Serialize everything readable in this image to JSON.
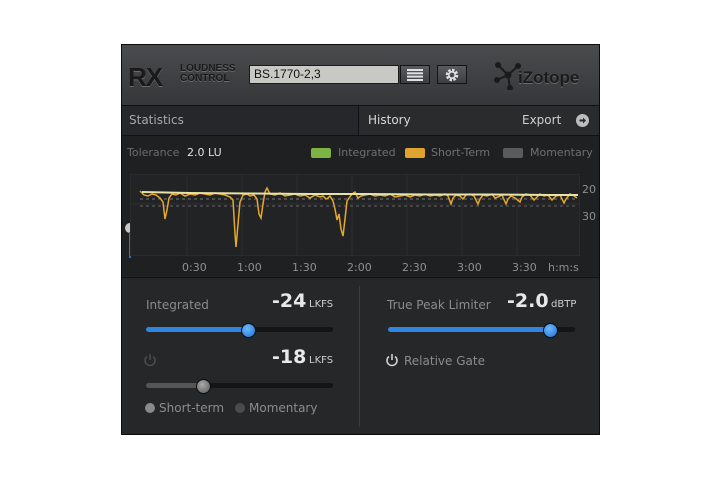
{
  "header": {
    "logo": "RX",
    "logo_sub_line1": "LOUDNESS",
    "logo_sub_line2": "CONTROL",
    "preset_value": "BS.1770-2,3",
    "brand": "iZotope"
  },
  "tabs": {
    "statistics": "Statistics",
    "history": "History",
    "export": "Export"
  },
  "history": {
    "tolerance_label": "Tolerance",
    "tolerance_value": "2.0 LU",
    "legend": [
      {
        "label": "Integrated",
        "color": "#7cb342"
      },
      {
        "label": "Short-Term",
        "color": "#e0a32e"
      },
      {
        "label": "Momentary",
        "color": "#5a5b5c"
      }
    ],
    "time_labels": [
      "0:30",
      "1:00",
      "1:30",
      "2:00",
      "2:30",
      "3:00",
      "3:30"
    ],
    "time_unit": "h:m:s",
    "y_labels": [
      "20",
      "30"
    ]
  },
  "controls": {
    "integrated": {
      "label": "Integrated",
      "value": "-24",
      "unit": "LKFS",
      "slider_fraction": 0.54
    },
    "short_term_target": {
      "value": "-18",
      "unit": "LKFS",
      "slider_fraction": 0.3
    },
    "mode_options": [
      "Short-term",
      "Momentary"
    ],
    "true_peak": {
      "label": "True Peak Limiter",
      "value": "-2.0",
      "unit": "dBTP",
      "slider_fraction": 0.86
    },
    "relative_gate": "Relative Gate"
  },
  "colors": {
    "accent_blue": "#2f86e0",
    "short_term_line": "#f1c232",
    "integrated_line": "#e8e8b0"
  }
}
